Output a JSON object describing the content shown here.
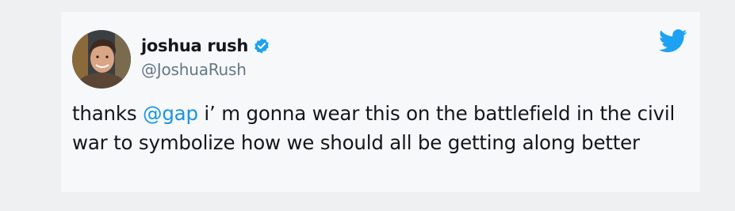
{
  "tweet": {
    "author": {
      "display_name": "joshua rush",
      "handle": "@JoshuaRush",
      "verified": true,
      "avatar_icon": "user-avatar-photo"
    },
    "text_before": "thanks ",
    "mention": "@gap",
    "text_after": " i’  m gonna wear this on the battlefield in the civil war to symbolize how we should all be getting along better",
    "platform_icon": "twitter-bird-icon",
    "colors": {
      "accent": "#1da1f2",
      "mention": "#1b95e0",
      "text": "#14171a",
      "muted": "#657786"
    }
  }
}
